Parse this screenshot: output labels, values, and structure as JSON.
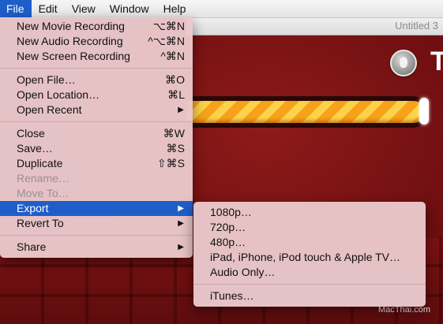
{
  "menubar": {
    "items": [
      "File",
      "Edit",
      "View",
      "Window",
      "Help"
    ]
  },
  "window": {
    "title": "Untitled 3"
  },
  "file_menu": {
    "groups": [
      [
        {
          "label": "New Movie Recording",
          "shortcut": "⌥⌘N",
          "enabled": true
        },
        {
          "label": "New Audio Recording",
          "shortcut": "^⌥⌘N",
          "enabled": true
        },
        {
          "label": "New Screen Recording",
          "shortcut": "^⌘N",
          "enabled": true
        }
      ],
      [
        {
          "label": "Open File…",
          "shortcut": "⌘O",
          "enabled": true
        },
        {
          "label": "Open Location…",
          "shortcut": "⌘L",
          "enabled": true
        },
        {
          "label": "Open Recent",
          "submenu": true,
          "enabled": true
        }
      ],
      [
        {
          "label": "Close",
          "shortcut": "⌘W",
          "enabled": true
        },
        {
          "label": "Save…",
          "shortcut": "⌘S",
          "enabled": true
        },
        {
          "label": "Duplicate",
          "shortcut": "⇧⌘S",
          "enabled": true
        },
        {
          "label": "Rename…",
          "enabled": false
        },
        {
          "label": "Move To…",
          "enabled": false
        },
        {
          "label": "Export",
          "submenu": true,
          "enabled": true,
          "highlighted": true
        },
        {
          "label": "Revert To",
          "submenu": true,
          "enabled": true
        }
      ],
      [
        {
          "label": "Share",
          "submenu": true,
          "enabled": true
        }
      ]
    ]
  },
  "export_menu": {
    "groups": [
      [
        "1080p…",
        "720p…",
        "480p…",
        "iPad, iPhone, iPod touch & Apple TV…",
        "Audio Only…"
      ],
      [
        "iTunes…"
      ]
    ]
  },
  "watermark": "MacThai.com",
  "colors": {
    "accent": "#1e5ec9",
    "menu_bg": "#e9c8cb",
    "game_bg": "#7a1213"
  }
}
